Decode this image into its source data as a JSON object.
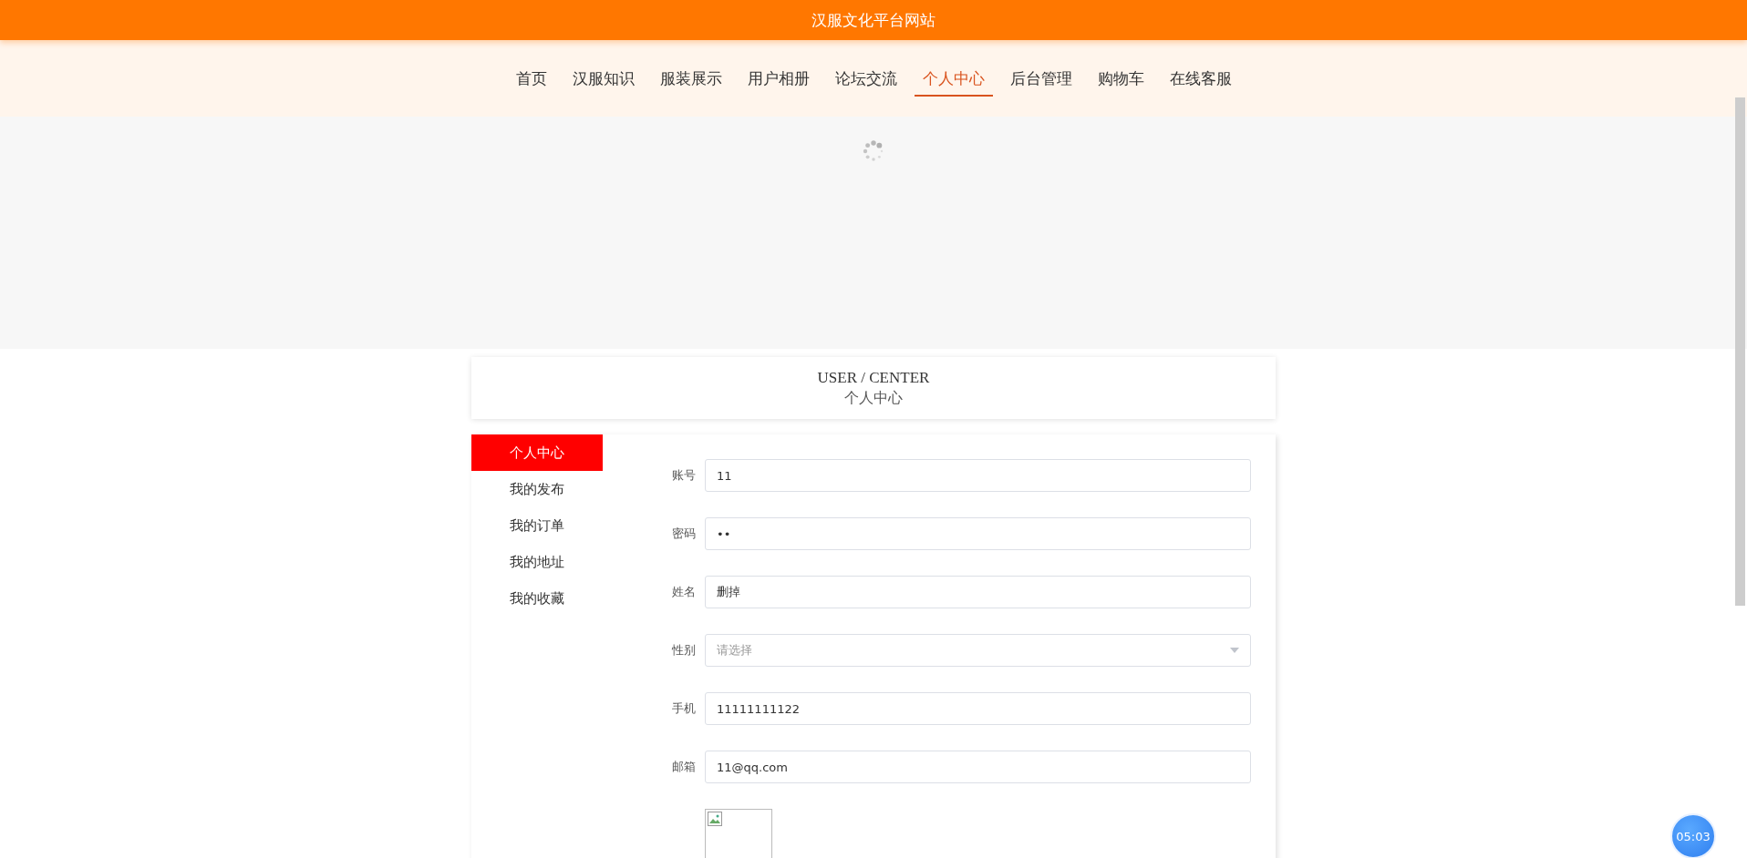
{
  "header": {
    "title": "汉服文化平台网站"
  },
  "nav": [
    {
      "label": "首页",
      "selected": false
    },
    {
      "label": "汉服知识",
      "selected": false
    },
    {
      "label": "服装展示",
      "selected": false
    },
    {
      "label": "用户相册",
      "selected": false
    },
    {
      "label": "论坛交流",
      "selected": false
    },
    {
      "label": "个人中心",
      "selected": true
    },
    {
      "label": "后台管理",
      "selected": false
    },
    {
      "label": "购物车",
      "selected": false
    },
    {
      "label": "在线客服",
      "selected": false
    }
  ],
  "title_card": {
    "english": "USER / CENTER",
    "chinese": "个人中心"
  },
  "side_menu": [
    {
      "label": "个人中心",
      "selected": true
    },
    {
      "label": "我的发布",
      "selected": false
    },
    {
      "label": "我的订单",
      "selected": false
    },
    {
      "label": "我的地址",
      "selected": false
    },
    {
      "label": "我的收藏",
      "selected": false
    }
  ],
  "form": [
    {
      "kind": "text",
      "label": "账号",
      "value": "11"
    },
    {
      "kind": "text",
      "label": "密码",
      "value": "••"
    },
    {
      "kind": "text",
      "label": "姓名",
      "value": "删掉"
    },
    {
      "kind": "select",
      "label": "性别",
      "placeholder": "请选择"
    },
    {
      "kind": "text",
      "label": "手机",
      "value": "11111111122"
    },
    {
      "kind": "text",
      "label": "邮箱",
      "value": "11@qq.com"
    }
  ],
  "timer": {
    "text": "05:03"
  }
}
